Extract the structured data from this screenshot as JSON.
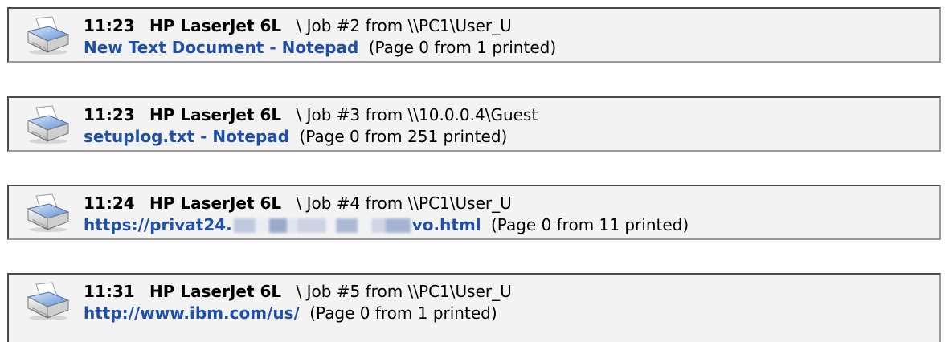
{
  "jobs": [
    {
      "time": "11:23",
      "printer": "HP LaserJet 6L",
      "job_info": "\\ Job #2 from \\\\PC1\\User_U",
      "document": "New Text Document - Notepad",
      "document_suffix": "",
      "pages": "(Page 0 from 1 printed)",
      "icon": "printer-icon"
    },
    {
      "time": "11:23",
      "printer": "HP LaserJet 6L",
      "job_info": "\\ Job #3 from \\\\10.0.0.4\\Guest",
      "document": "setuplog.txt - Notepad",
      "document_suffix": "",
      "pages": "(Page 0 from 251 printed)",
      "icon": "printer-icon"
    },
    {
      "time": "11:24",
      "printer": "HP LaserJet 6L",
      "job_info": "\\ Job #4 from \\\\PC1\\User_U",
      "document": "https://privat24.",
      "document_suffix": "vo.html",
      "pages": "(Page 0 from 11 printed)",
      "icon": "printer-icon"
    },
    {
      "time": "11:31",
      "printer": "HP LaserJet 6L",
      "job_info": "\\ Job #5 from \\\\PC1\\User_U",
      "document": "http://www.ibm.com/us/",
      "document_suffix": "",
      "pages": "(Page 0 from 1 printed)",
      "icon": "printer-icon"
    }
  ],
  "colors": {
    "document_link": "#1f4fa6",
    "row_background": "#f3f3f3",
    "row_border": "#4a4a4a"
  }
}
